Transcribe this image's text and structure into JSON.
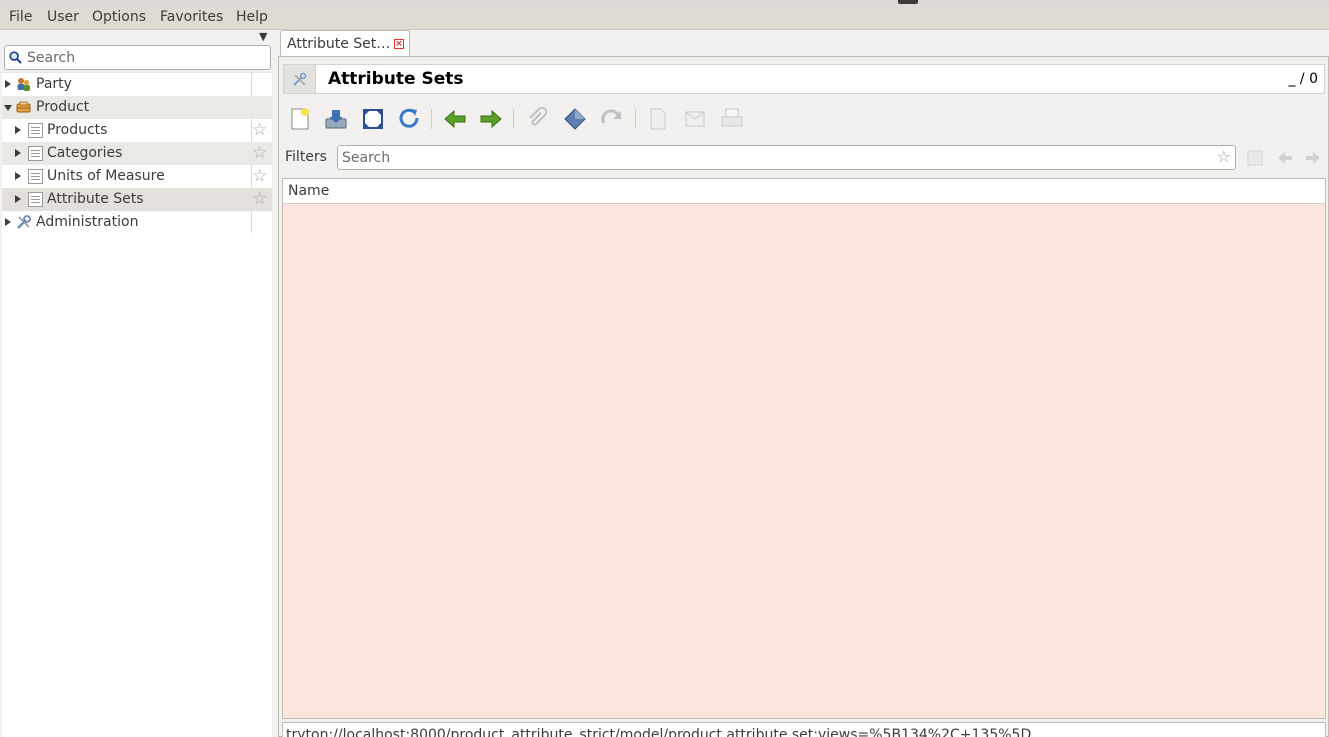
{
  "menu": [
    "File",
    "User",
    "Options",
    "Favorites",
    "Help"
  ],
  "sidebar": {
    "search_placeholder": "Search",
    "items": [
      {
        "label": "Party",
        "icon": "party-icon",
        "expander": "collapsed",
        "level": 0,
        "favorite": false
      },
      {
        "label": "Product",
        "icon": "product-icon",
        "expander": "expanded",
        "level": 0,
        "favorite": false
      },
      {
        "label": "Products",
        "icon": "list-icon",
        "expander": "collapsed",
        "level": 1,
        "favorite": true
      },
      {
        "label": "Categories",
        "icon": "list-icon",
        "expander": "collapsed",
        "level": 1,
        "favorite": true
      },
      {
        "label": "Units of Measure",
        "icon": "list-icon",
        "expander": "collapsed",
        "level": 1,
        "favorite": true
      },
      {
        "label": "Attribute Sets",
        "icon": "list-icon",
        "expander": "collapsed",
        "level": 1,
        "favorite": true
      },
      {
        "label": "Administration",
        "icon": "admin-icon",
        "expander": "collapsed",
        "level": 0,
        "favorite": false
      }
    ]
  },
  "tab": {
    "label": "Attribute Set…",
    "close": "×"
  },
  "view": {
    "title": "Attribute Sets",
    "record_count": "_ / 0",
    "toolbar": [
      "new-icon",
      "save-icon",
      "switch-view-icon",
      "reload-icon",
      "previous-icon",
      "next-icon",
      "attachment-icon",
      "action-icon",
      "relate-icon",
      "report-icon",
      "email-icon",
      "print-icon"
    ],
    "filters_label": "Filters",
    "filters_placeholder": "Search",
    "columns": [
      "Name"
    ],
    "rows": []
  },
  "status_url": "tryton://localhost:8000/product_attribute_strict/model/product.attribute.set;views=%5B134%2C+135%5D",
  "colors": {
    "list_background": "#fce5dd",
    "menubar": "#dfdbd2",
    "window": "#f2f1f0"
  }
}
